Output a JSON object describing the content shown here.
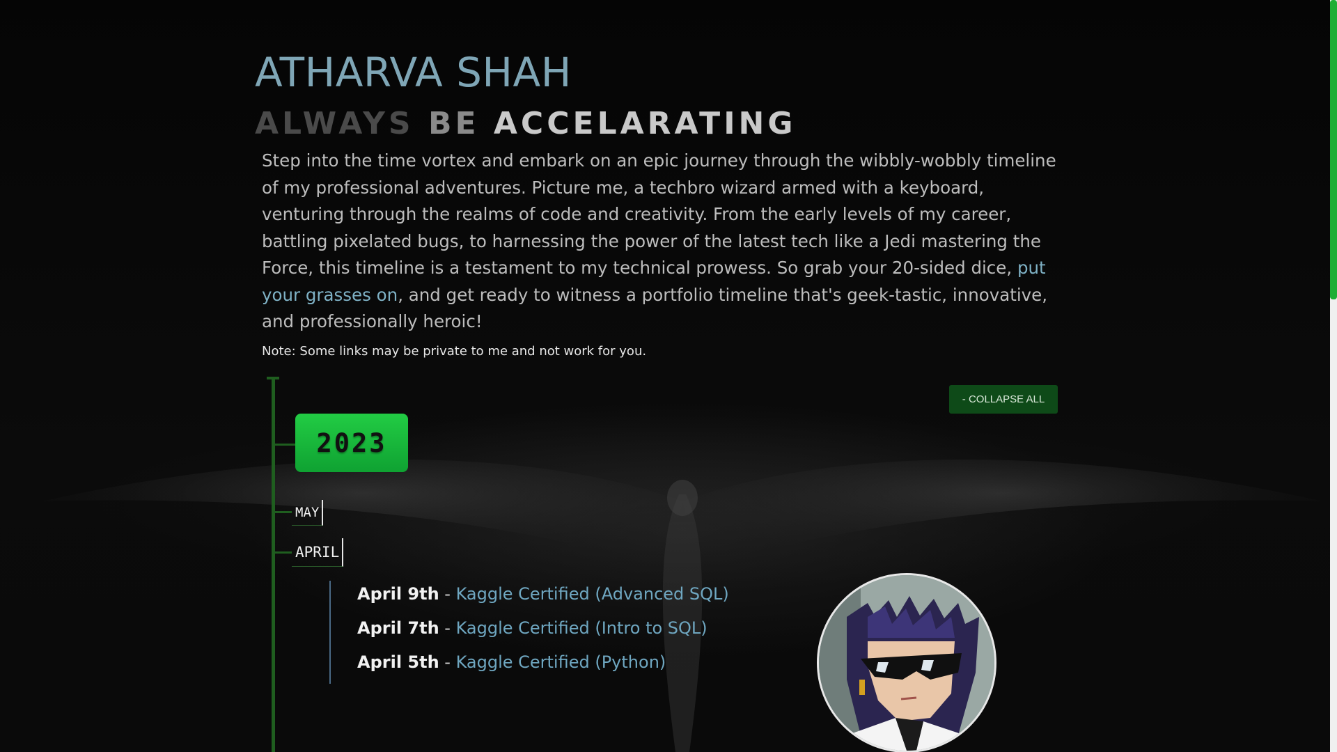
{
  "header": {
    "title": "ATHARVA SHAH",
    "tagline_words": [
      "ALWAYS",
      "BE",
      "ACCELARATING"
    ]
  },
  "intro": {
    "before_link": "Step into the time vortex and embark on an epic journey through the wibbly-wobbly timeline of my professional adventures. Picture me, a techbro wizard armed with a keyboard, venturing through the realms of code and creativity. From the early levels of my career, battling pixelated bugs, to harnessing the power of the latest tech like a Jedi mastering the Force, this timeline is a testament to my technical prowess. So grab your 20-sided dice, ",
    "link_text": "put your grasses on",
    "after_link": ", and get ready to witness a portfolio timeline that's geek-tastic, innovative, and professionally heroic!"
  },
  "note": "Note: Some links may be private to me and not work for you.",
  "controls": {
    "collapse_label": "- COLLAPSE ALL"
  },
  "timeline": {
    "year": "2023",
    "months": [
      {
        "label": "MAY"
      },
      {
        "label": "APRIL"
      }
    ],
    "entries": [
      {
        "date": "April 9th",
        "separator": " - ",
        "link": "Kaggle Certified (Advanced SQL)"
      },
      {
        "date": "April 7th",
        "separator": " - ",
        "link": "Kaggle Certified (Intro to SQL)"
      },
      {
        "date": "April 5th",
        "separator": " - ",
        "link": "Kaggle Certified (Python)"
      }
    ]
  },
  "colors": {
    "accent_green": "#1fae35",
    "title_blue": "#7fa6b6",
    "link_blue": "#6fa7c1",
    "background": "#060606"
  },
  "icons": {
    "avatar": "anime-avatar-sunglasses"
  }
}
